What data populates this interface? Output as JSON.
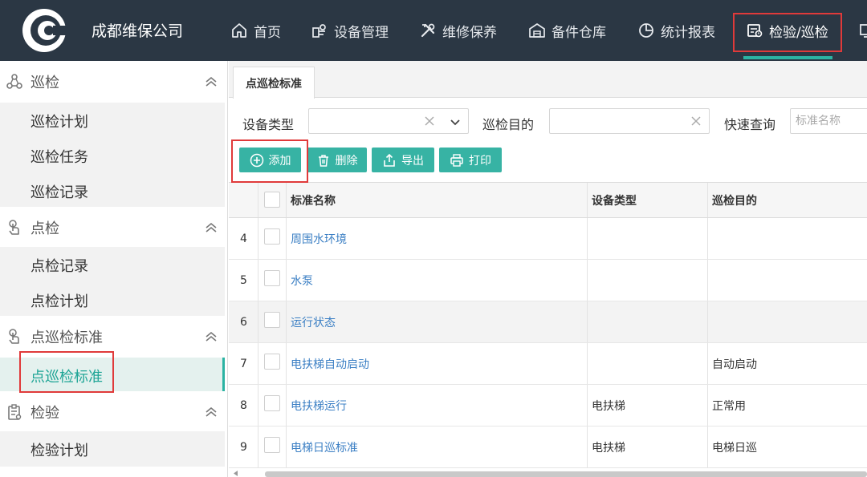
{
  "header": {
    "company": "成都维保公司",
    "nav": [
      {
        "label": "首页",
        "icon": "home-icon"
      },
      {
        "label": "设备管理",
        "icon": "device-icon"
      },
      {
        "label": "维修保养",
        "icon": "tools-icon"
      },
      {
        "label": "备件仓库",
        "icon": "warehouse-icon"
      },
      {
        "label": "统计报表",
        "icon": "pie-chart-icon"
      },
      {
        "label": "检验/巡检",
        "icon": "inspection-icon",
        "active": true
      }
    ]
  },
  "sidebar": {
    "groups": [
      {
        "label": "巡检",
        "icon": "patrol-icon",
        "items": [
          "巡检计划",
          "巡检任务",
          "巡检记录"
        ]
      },
      {
        "label": "点检",
        "icon": "touch-icon",
        "items": [
          "点检记录",
          "点检计划"
        ]
      },
      {
        "label": "点巡检标准",
        "icon": "touch-icon",
        "items": [
          "点巡检标准"
        ],
        "active_item": 0
      },
      {
        "label": "检验",
        "icon": "clipboard-icon",
        "items": [
          "检验计划"
        ]
      }
    ]
  },
  "main": {
    "tab": "点巡检标准",
    "filters": {
      "device_type_label": "设备类型",
      "patrol_purpose_label": "巡检目的",
      "quick_search_label": "快速查询",
      "quick_search_placeholder": "标准名称"
    },
    "buttons": {
      "add": "添加",
      "delete": "删除",
      "export": "导出",
      "print": "打印"
    },
    "table": {
      "columns": [
        "标准名称",
        "设备类型",
        "巡检目的"
      ],
      "rows": [
        {
          "no": "4",
          "name": "周围水环境",
          "device_type": "",
          "purpose": ""
        },
        {
          "no": "5",
          "name": "水泵",
          "device_type": "",
          "purpose": ""
        },
        {
          "no": "6",
          "name": "运行状态",
          "device_type": "",
          "purpose": ""
        },
        {
          "no": "7",
          "name": "电扶梯自动启动",
          "device_type": "",
          "purpose": "自动启动"
        },
        {
          "no": "8",
          "name": "电扶梯运行",
          "device_type": "电扶梯",
          "purpose": "正常用"
        },
        {
          "no": "9",
          "name": "电梯日巡标准",
          "device_type": "电扶梯",
          "purpose": "电梯日巡"
        }
      ]
    }
  },
  "colors": {
    "header_bg": "#2b3744",
    "accent": "#37b3a4",
    "highlight_box": "#e03a3a",
    "link": "#3b7fc4"
  }
}
